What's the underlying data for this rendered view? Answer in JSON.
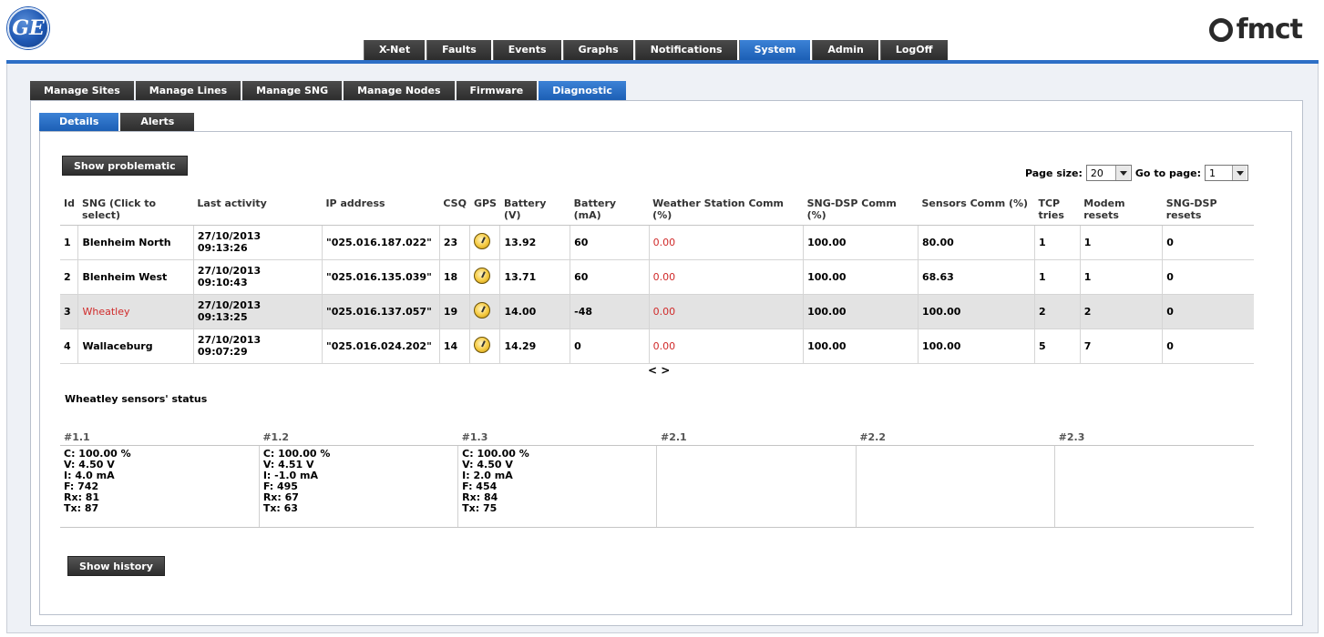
{
  "header": {
    "ge_logo_text": "GE",
    "fmct_logo_text": "fmct",
    "main_tabs": [
      {
        "label": "X-Net",
        "active": false
      },
      {
        "label": "Faults",
        "active": false
      },
      {
        "label": "Events",
        "active": false
      },
      {
        "label": "Graphs",
        "active": false
      },
      {
        "label": "Notifications",
        "active": false
      },
      {
        "label": "System",
        "active": true
      },
      {
        "label": "Admin",
        "active": false
      },
      {
        "label": "LogOff",
        "active": false
      }
    ]
  },
  "sub_tabs": [
    {
      "label": "Manage Sites",
      "active": false
    },
    {
      "label": "Manage Lines",
      "active": false
    },
    {
      "label": "Manage SNG",
      "active": false
    },
    {
      "label": "Manage Nodes",
      "active": false
    },
    {
      "label": "Firmware",
      "active": false
    },
    {
      "label": "Diagnostic",
      "active": true
    }
  ],
  "inner_tabs": [
    {
      "label": "Details",
      "active": true
    },
    {
      "label": "Alerts",
      "active": false
    }
  ],
  "toolbar": {
    "show_problematic_label": "Show problematic",
    "page_size_label": "Page size:",
    "page_size_value": "20",
    "go_to_page_label": "Go to page:",
    "go_to_page_value": "1"
  },
  "grid": {
    "columns": [
      "Id",
      "SNG (Click to select)",
      "Last activity",
      "IP address",
      "CSQ",
      "GPS",
      "Battery (V)",
      "Battery (mA)",
      "Weather Station Comm (%)",
      "SNG-DSP Comm (%)",
      "Sensors Comm (%)",
      "TCP tries",
      "Modem resets",
      "SNG-DSP resets"
    ],
    "rows": [
      {
        "id": "1",
        "sng": "Blenheim North",
        "last_date": "27/10/2013",
        "last_time": "09:13:26",
        "ip": "\"025.016.187.022\"",
        "csq": "23",
        "battery_v": "13.92",
        "battery_ma": "60",
        "weather": "0.00",
        "sng_dsp": "100.00",
        "sensors": "80.00",
        "tcp": "1",
        "modem": "1",
        "dsp_resets": "0"
      },
      {
        "id": "2",
        "sng": "Blenheim West",
        "last_date": "27/10/2013",
        "last_time": "09:10:43",
        "ip": "\"025.016.135.039\"",
        "csq": "18",
        "battery_v": "13.71",
        "battery_ma": "60",
        "weather": "0.00",
        "sng_dsp": "100.00",
        "sensors": "68.63",
        "tcp": "1",
        "modem": "1",
        "dsp_resets": "0"
      },
      {
        "id": "3",
        "sng": "Wheatley",
        "last_date": "27/10/2013",
        "last_time": "09:13:25",
        "ip": "\"025.016.137.057\"",
        "csq": "19",
        "battery_v": "14.00",
        "battery_ma": "-48",
        "weather": "0.00",
        "sng_dsp": "100.00",
        "sensors": "100.00",
        "tcp": "2",
        "modem": "2",
        "dsp_resets": "0"
      },
      {
        "id": "4",
        "sng": "Wallaceburg",
        "last_date": "27/10/2013",
        "last_time": "09:07:29",
        "ip": "\"025.016.024.202\"",
        "csq": "14",
        "battery_v": "14.29",
        "battery_ma": "0",
        "weather": "0.00",
        "sng_dsp": "100.00",
        "sensors": "100.00",
        "tcp": "5",
        "modem": "7",
        "dsp_resets": "0"
      }
    ],
    "scroll_arrows": "< >"
  },
  "sensors": {
    "title": "Wheatley sensors' status",
    "columns": [
      "#1.1",
      "#1.2",
      "#1.3",
      "#2.1",
      "#2.2",
      "#2.3"
    ],
    "cells": [
      [
        "C: 100.00 %",
        "V: 4.50 V",
        "I: 4.0 mA",
        "F: 742",
        "Rx: 81",
        "Tx: 87"
      ],
      [
        "C: 100.00 %",
        "V: 4.51 V",
        "I: -1.0 mA",
        "F: 495",
        "Rx: 67",
        "Tx: 63"
      ],
      [
        "C: 100.00 %",
        "V: 4.50 V",
        "I: 2.0 mA",
        "F: 454",
        "Rx: 84",
        "Tx: 75"
      ],
      [],
      [],
      []
    ]
  },
  "footer": {
    "show_history_label": "Show history"
  },
  "colors": {
    "accent_blue": "#2d6fc6",
    "warning_red": "#d02a2a",
    "tab_dark": "#2d2d2d"
  }
}
